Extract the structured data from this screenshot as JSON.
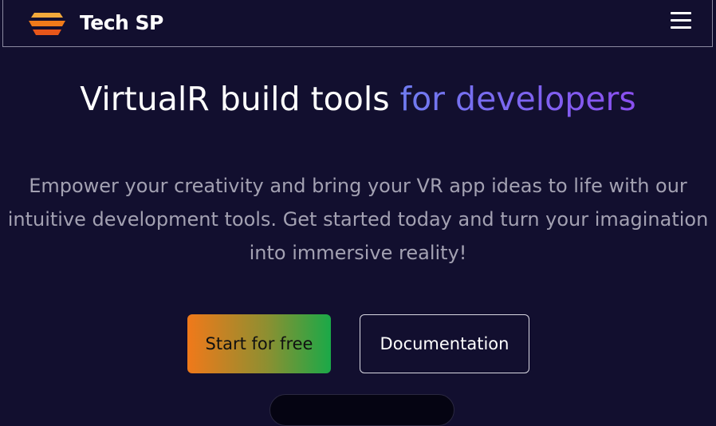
{
  "header": {
    "brand_name": "Tech SP",
    "logo_icon": "layered-stack-logo",
    "menu_icon": "hamburger-menu-icon"
  },
  "hero": {
    "title_main": "VirtualR build tools ",
    "title_accent": "for developers",
    "description": "Empower your creativity and bring your VR app ideas to life with our intuitive development tools. Get started today and turn your imagination into immersive reality!"
  },
  "actions": {
    "primary_label": "Start for free",
    "secondary_label": "Documentation"
  },
  "colors": {
    "background": "#120f2f",
    "accent_gradient_start": "#6f7cf0",
    "accent_gradient_end": "#8a4ff0",
    "primary_gradient_start": "#f0791a",
    "primary_gradient_end": "#1aa948"
  }
}
